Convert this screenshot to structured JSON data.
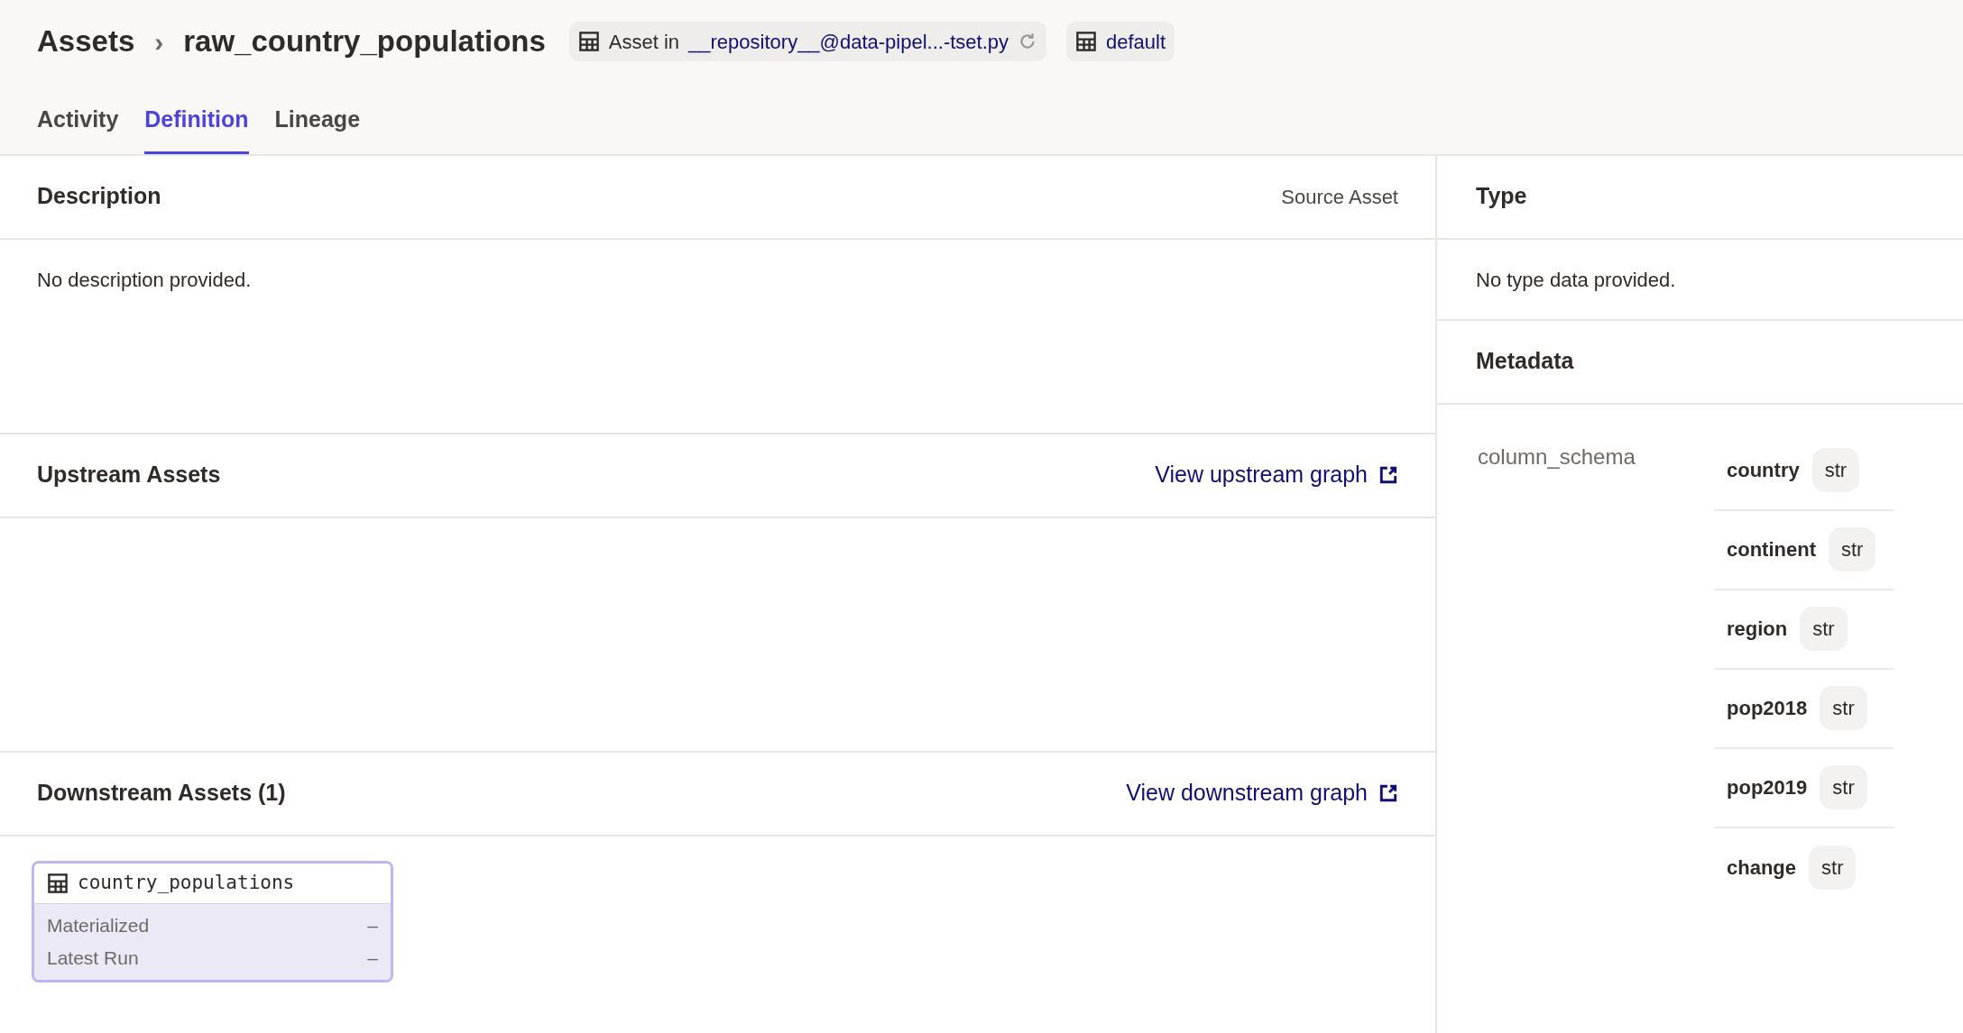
{
  "breadcrumb": {
    "root": "Assets",
    "separator": "›",
    "current": "raw_country_populations"
  },
  "location_tag": {
    "prefix": "Asset in",
    "link": "__repository__@data-pipel...-tset.py"
  },
  "group_tag": {
    "label": "default"
  },
  "tabs": [
    {
      "label": "Activity",
      "selected": false
    },
    {
      "label": "Definition",
      "selected": true
    },
    {
      "label": "Lineage",
      "selected": false
    }
  ],
  "description": {
    "title": "Description",
    "badge": "Source Asset",
    "text": "No description provided."
  },
  "upstream": {
    "title": "Upstream Assets",
    "link": "View upstream graph"
  },
  "downstream": {
    "title": "Downstream Assets (1)",
    "link": "View downstream graph",
    "assets": [
      {
        "name": "country_populations",
        "rows": [
          {
            "label": "Materialized",
            "value": "–"
          },
          {
            "label": "Latest Run",
            "value": "–"
          }
        ]
      }
    ]
  },
  "type": {
    "title": "Type",
    "text": "No type data provided."
  },
  "metadata": {
    "title": "Metadata",
    "key": "column_schema",
    "columns": [
      {
        "name": "country",
        "type": "str"
      },
      {
        "name": "continent",
        "type": "str"
      },
      {
        "name": "region",
        "type": "str"
      },
      {
        "name": "pop2018",
        "type": "str"
      },
      {
        "name": "pop2019",
        "type": "str"
      },
      {
        "name": "change",
        "type": "str"
      }
    ]
  }
}
